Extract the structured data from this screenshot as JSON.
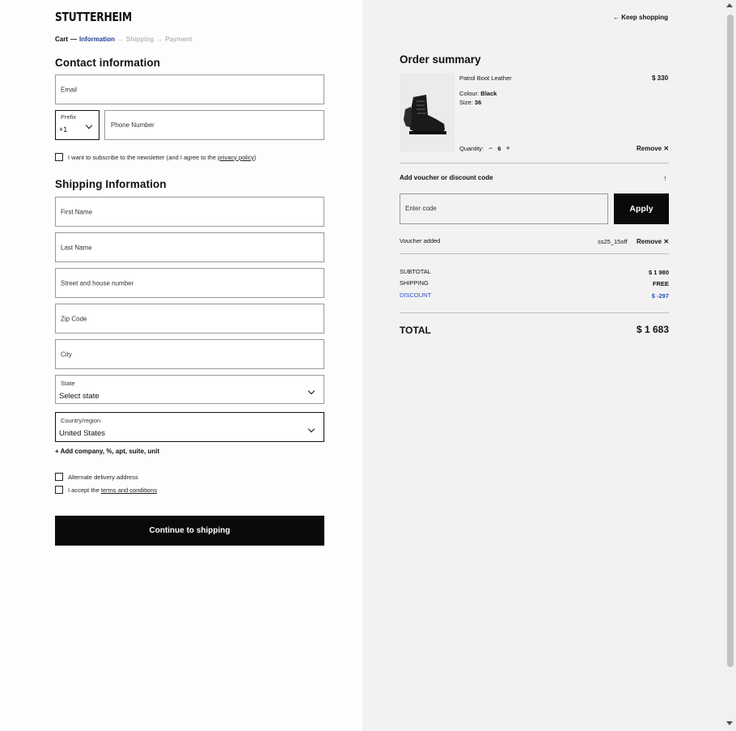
{
  "brand": {
    "logo": "STUTTERHEIM"
  },
  "breadcrumb": {
    "cart": "Cart",
    "information": "Information",
    "shipping": "Shipping",
    "payment": "Payment",
    "sep": "—",
    "sep_arrow": "→"
  },
  "contact": {
    "title": "Contact information",
    "email_placeholder": "Email",
    "prefix_label": "Prefix",
    "prefix_value": "+1",
    "phone_placeholder": "Phone Number",
    "newsletter_text": "I want to subscribe to the newsletter (and I agree to the",
    "privacy_link": "privacy policy",
    "newsletter_end": ")"
  },
  "shipping": {
    "title": "Shipping Information",
    "first_name": "First Name",
    "last_name": "Last Name",
    "street": "Street and house number",
    "zip": "Zip Code",
    "city": "City",
    "state_label": "State",
    "state_value": "Select state",
    "country_label": "Country/region",
    "country_value": "United States",
    "add_company": "+ Add company, %, apt, suite, unit",
    "alternate_delivery": "Alternate delivery address",
    "accept_prefix": "I accept the",
    "terms_link": "terms and conditions",
    "continue_button": "Continue to shipping"
  },
  "summary": {
    "keep_shopping": "← Keep shopping",
    "title": "Order summary",
    "product": {
      "name": "Patrol Boot Leather",
      "price": "$ 330",
      "colour_label": "Colour:",
      "colour_value": "Black",
      "size_label": "Size:",
      "size_value": "36",
      "quantity_label": "Quantity:",
      "quantity_minus": "−",
      "quantity_value": "6",
      "quantity_plus": "+",
      "remove": "Remove ✕"
    },
    "voucher": {
      "heading": "Add voucher or discount code",
      "toggle_icon": "↑",
      "code_placeholder": "Enter code",
      "apply_button": "Apply",
      "added_label": "Voucher added",
      "added_code": "ss25_15off",
      "remove": "Remove ✕"
    },
    "totals": {
      "subtotal_label": "SUBTOTAL",
      "subtotal_value": "$ 1 980",
      "shipping_label": "SHIPPING",
      "shipping_value": "FREE",
      "discount_label": "DISCOUNT",
      "discount_value": "$ -297",
      "total_label": "TOTAL",
      "total_value": "$ 1 683"
    }
  },
  "colors": {
    "accent_blue": "#2b4cc4",
    "breadcrumb_active": "#1f3f8f",
    "button_black": "#0a0a0a"
  }
}
